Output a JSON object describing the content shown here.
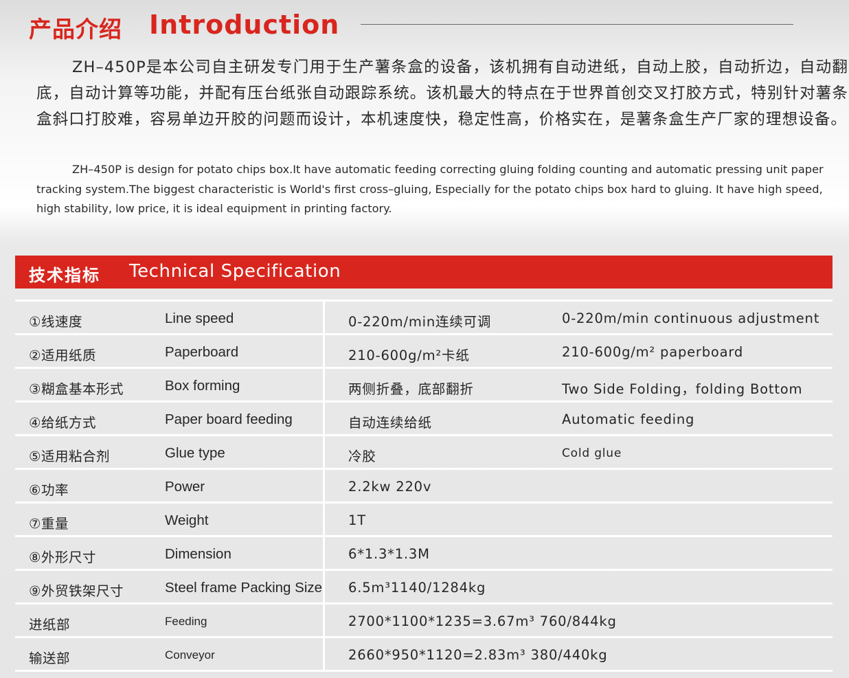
{
  "intro": {
    "title_cn": "产品介绍",
    "title_en": "Introduction",
    "paragraph_cn": "ZH–450P是本公司自主研发专门用于生产薯条盒的设备，该机拥有自动进纸，自动上胶，自动折边，自动翻底，自动计算等功能，并配有压台纸张自动跟踪系统。该机最大的特点在于世界首创交叉打胶方式，特别针对薯条盒斜口打胶难，容易单边开胶的问题而设计，本机速度快，稳定性高，价格实在，是薯条盒生产厂家的理想设备。",
    "paragraph_en": "ZH–450P is design for potato chips box.It have automatic feeding correcting gluing folding counting and automatic pressing unit paper tracking system.The biggest characteristic is World's first cross–gluing, Especially for the potato chips box hard to gluing. It have high speed, high stability, low price,  it is ideal equipment in printing factory."
  },
  "spec": {
    "title_cn": "技术指标",
    "title_en": "Technical Specification",
    "rows": [
      {
        "label_cn": "①线速度",
        "label_en": "Line speed",
        "value_cn": "0-220m/min连续可调",
        "value_en": "0-220m/min continuous adjustment"
      },
      {
        "label_cn": "②适用纸质",
        "label_en": "Paperboard",
        "value_cn": "210-600g/m²卡纸",
        "value_en": "210-600g/m² paperboard"
      },
      {
        "label_cn": "③糊盒基本形式",
        "label_en": "Box forming",
        "value_cn": "两侧折叠，底部翻折",
        "value_en": "Two Side Folding，folding Bottom"
      },
      {
        "label_cn": "④给纸方式",
        "label_en": "Paper board feeding",
        "value_cn": "自动连续给纸",
        "value_en": "Automatic feeding"
      },
      {
        "label_cn": "⑤适用粘合剂",
        "label_en": "Glue type",
        "value_cn": "冷胶",
        "value_en": "Cold glue"
      },
      {
        "label_cn": "⑥功率",
        "label_en": "Power",
        "value_cn": "2.2kw 220v",
        "value_en": ""
      },
      {
        "label_cn": "⑦重量",
        "label_en": "Weight",
        "value_cn": "1T",
        "value_en": ""
      },
      {
        "label_cn": "⑧外形尺寸",
        "label_en": "Dimension",
        "value_cn": "6*1.3*1.3M",
        "value_en": ""
      },
      {
        "label_cn": "⑨外贸铁架尺寸",
        "label_en": "Steel frame Packing Size",
        "value_cn": "6.5m³1140/1284kg",
        "value_en": ""
      },
      {
        "label_cn": "进纸部",
        "label_en": "Feeding",
        "value_cn": "2700*1100*1235=3.67m³ 760/844kg",
        "value_en": ""
      },
      {
        "label_cn": "输送部",
        "label_en": "Conveyor",
        "value_cn": "2660*950*1120=2.83m³ 380/440kg",
        "value_en": ""
      }
    ]
  }
}
